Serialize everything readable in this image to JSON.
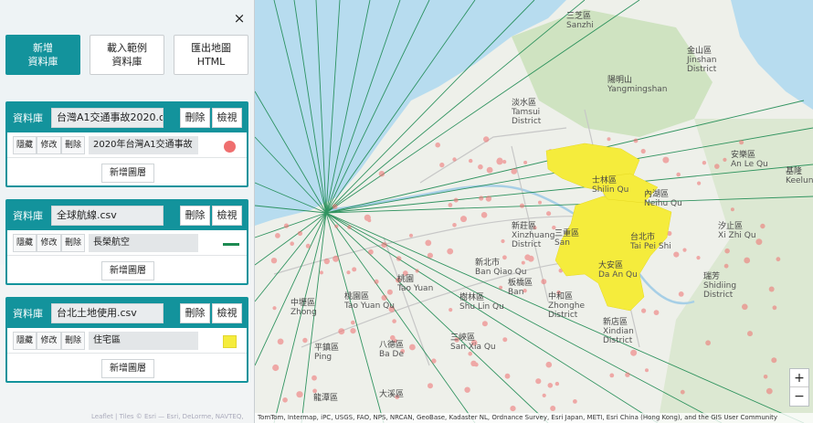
{
  "panel": {
    "close_label": "×",
    "buttons": [
      {
        "label_line1": "新增",
        "label_line2": "資料庫"
      },
      {
        "label_line1": "載入範例",
        "label_line2": "資料庫"
      },
      {
        "label_line1": "匯出地圖",
        "label_line2": "HTML"
      }
    ],
    "card_label": "資料庫",
    "delete_label": "刪除",
    "view_label": "檢視",
    "hide_label": "隱藏",
    "edit_label": "修改",
    "layer_delete_label": "刪除",
    "add_layer_label": "新增圖層",
    "databases": [
      {
        "name": "台灣A1交通事故2020.c",
        "layer_name": "2020年台灣A1交通事故",
        "symbol": "circle",
        "symbol_color": "#ef6f6f"
      },
      {
        "name": "全球航線.csv",
        "layer_name": "長榮航空",
        "symbol": "line",
        "symbol_color": "#1d8a52"
      },
      {
        "name": "台北土地使用.csv",
        "layer_name": "住宅區",
        "symbol": "fill",
        "symbol_color": "#f5ec3c"
      }
    ]
  },
  "map": {
    "places": [
      {
        "zh": "淡水區",
        "en": "Tamsui",
        "en2": "District"
      },
      {
        "zh": "三芝區",
        "en": "Sanzhi",
        "en2": ""
      },
      {
        "zh": "金山區",
        "en": "Jinshan",
        "en2": "District"
      },
      {
        "zh": "陽明山",
        "en": "Yangmingshan",
        "en2": ""
      },
      {
        "zh": "士林區",
        "en": "Shilin Qu",
        "en2": ""
      },
      {
        "zh": "內湖區",
        "en": "Neihu Qu",
        "en2": ""
      },
      {
        "zh": "汐止區",
        "en": "Xi Zhi Qu",
        "en2": ""
      },
      {
        "zh": "安樂區",
        "en": "An Le Qu",
        "en2": ""
      },
      {
        "zh": "新莊區",
        "en": "Xinzhuang",
        "en2": "District"
      },
      {
        "zh": "三重區",
        "en": "San",
        "en2": ""
      },
      {
        "zh": "台北市",
        "en": "Tai Pei Shi",
        "en2": ""
      },
      {
        "zh": "大安區",
        "en": "Da An Qu",
        "en2": ""
      },
      {
        "zh": "新北市",
        "en": "Ban Qiao Qu",
        "en2": ""
      },
      {
        "zh": "板橋區",
        "en": "Ban",
        "en2": ""
      },
      {
        "zh": "中和區",
        "en": "Zhonghe",
        "en2": "District"
      },
      {
        "zh": "新店區",
        "en": "Xindian",
        "en2": "District"
      },
      {
        "zh": "桃園",
        "en": "Tao Yuan",
        "en2": ""
      },
      {
        "zh": "樹林區",
        "en": "Shu Lin Qu",
        "en2": ""
      },
      {
        "zh": "桃園區",
        "en": "Tao Yuan Qu",
        "en2": ""
      },
      {
        "zh": "中壢區",
        "en": "Zhong",
        "en2": ""
      },
      {
        "zh": "平鎮區",
        "en": "Ping",
        "en2": ""
      },
      {
        "zh": "八德區",
        "en": "Ba De",
        "en2": ""
      },
      {
        "zh": "三峽區",
        "en": "San Xia Qu",
        "en2": ""
      },
      {
        "zh": "龍潭區",
        "en": "",
        "en2": ""
      },
      {
        "zh": "大溪區",
        "en": "",
        "en2": ""
      },
      {
        "zh": "瑞芳",
        "en": "Shidiing",
        "en2": "District"
      },
      {
        "zh": "基隆",
        "en": "Keelun",
        "en2": ""
      }
    ],
    "attribution": "TomTom, Intermap, iPC, USGS, FAO, NPS, NRCAN, GeoBase, Kadaster NL, Ordnance Survey, Esri Japan, METI, Esri China (Hong Kong), and the GIS User Community",
    "watermark": "Leaflet | Tiles © Esri — Esri, DeLorme, NAVTEQ,",
    "zoom_in_label": "+",
    "zoom_out_label": "−",
    "colors": {
      "sea": "#b7dcef",
      "land": "#eef0ea",
      "green": "#cfe3c1",
      "route": "#1d8a52",
      "accident": "#ef6f6f",
      "residential": "#f5ec3c"
    }
  }
}
